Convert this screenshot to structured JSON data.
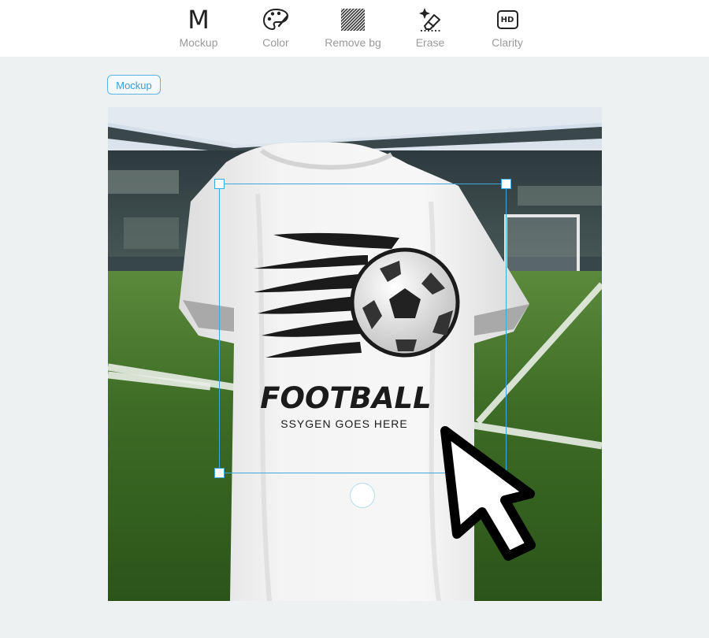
{
  "toolbar": {
    "items": [
      {
        "id": "mockup",
        "label": "Mockup",
        "icon": "mockup-letter-icon",
        "glyph": "M"
      },
      {
        "id": "color",
        "label": "Color",
        "icon": "palette-icon"
      },
      {
        "id": "remove_bg",
        "label": "Remove bg",
        "icon": "hatch-icon"
      },
      {
        "id": "erase",
        "label": "Erase",
        "icon": "eraser-sparkle-icon"
      },
      {
        "id": "clarity",
        "label": "Clarity",
        "icon": "hd-icon",
        "glyph": "HD"
      }
    ]
  },
  "badge": {
    "label": "Mockup"
  },
  "artwork": {
    "title": "FOOTBALL",
    "subtitle": "SSYGEN GOES HERE"
  },
  "colors": {
    "accent": "#3fa7df",
    "background": "#edf1f2",
    "text_muted": "#9a9a9a"
  }
}
